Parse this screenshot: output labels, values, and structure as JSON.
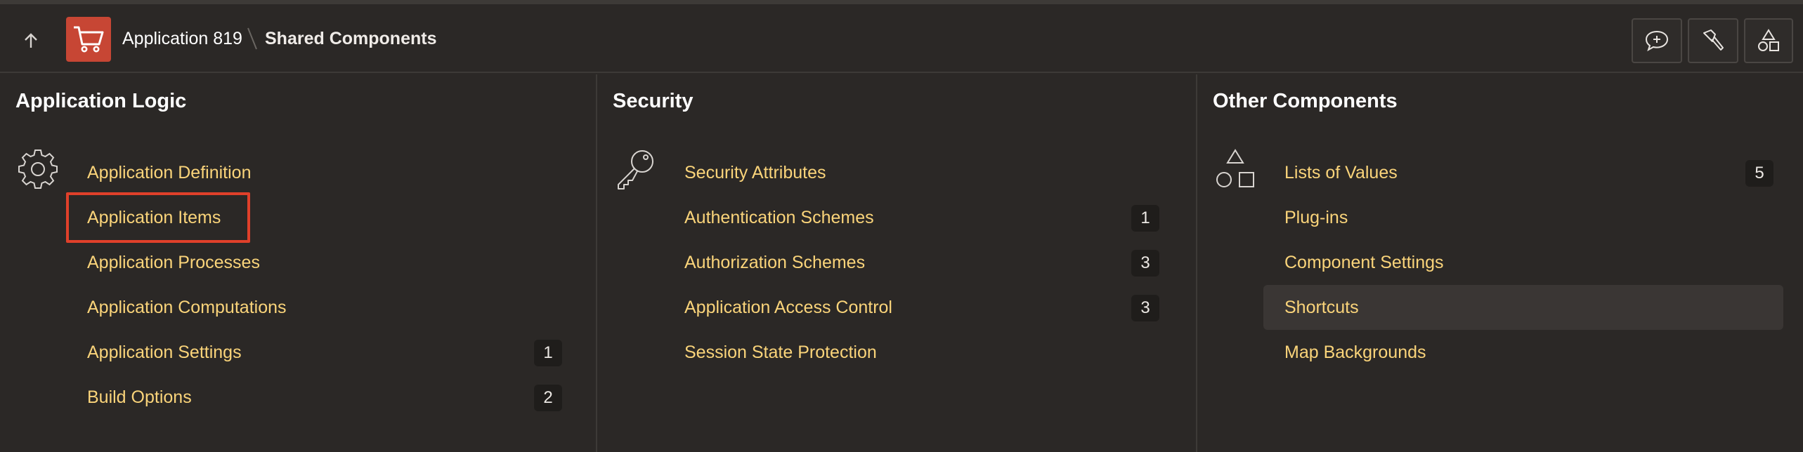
{
  "header": {
    "app_name": "Application 819",
    "current_page": "Shared Components",
    "tools": [
      {
        "icon": "feedback-icon"
      },
      {
        "icon": "flashlight-icon"
      },
      {
        "icon": "shapes-icon"
      }
    ]
  },
  "columns": [
    {
      "title": "Application Logic",
      "icon": "gear-icon",
      "items": [
        {
          "label": "Application Definition",
          "badge": ""
        },
        {
          "label": "Application Items",
          "badge": ""
        },
        {
          "label": "Application Processes",
          "badge": ""
        },
        {
          "label": "Application Computations",
          "badge": ""
        },
        {
          "label": "Application Settings",
          "badge": "1"
        },
        {
          "label": "Build Options",
          "badge": "2"
        }
      ]
    },
    {
      "title": "Security",
      "icon": "key-icon",
      "items": [
        {
          "label": "Security Attributes",
          "badge": ""
        },
        {
          "label": "Authentication Schemes",
          "badge": "1"
        },
        {
          "label": "Authorization Schemes",
          "badge": "3"
        },
        {
          "label": "Application Access Control",
          "badge": "3"
        },
        {
          "label": "Session State Protection",
          "badge": ""
        }
      ]
    },
    {
      "title": "Other Components",
      "icon": "shapes-icon",
      "items": [
        {
          "label": "Lists of Values",
          "badge": "5"
        },
        {
          "label": "Plug-ins",
          "badge": ""
        },
        {
          "label": "Component Settings",
          "badge": ""
        },
        {
          "label": "Shortcuts",
          "badge": ""
        },
        {
          "label": "Map Backgrounds",
          "badge": ""
        }
      ]
    }
  ],
  "colors": {
    "background": "#2b2826",
    "link": "#fad47a",
    "app_icon": "#c74634",
    "highlight_border": "#e0402a"
  }
}
